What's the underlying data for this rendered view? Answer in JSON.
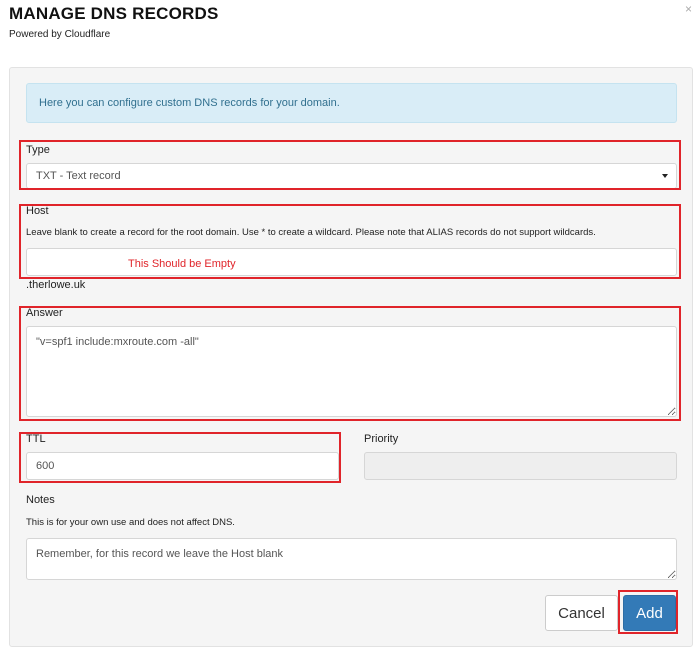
{
  "header": {
    "title": "MANAGE DNS RECORDS",
    "subtitle": "Powered by Cloudflare",
    "close_glyph": "×"
  },
  "info": {
    "text": "Here you can configure custom DNS records for your domain."
  },
  "form": {
    "type": {
      "label": "Type",
      "value": "TXT - Text record"
    },
    "host": {
      "label": "Host",
      "help": "Leave blank to create a record for the root domain. Use * to create a wildcard. Please note that ALIAS records do not support wildcards.",
      "value": "",
      "annotation": "This Should be Empty",
      "suffix": ".therlowe.uk"
    },
    "answer": {
      "label": "Answer",
      "value": "\"v=spf1 include:mxroute.com -all\""
    },
    "ttl": {
      "label": "TTL",
      "value": "600"
    },
    "priority": {
      "label": "Priority",
      "value": ""
    },
    "notes": {
      "label": "Notes",
      "help": "This is for your own use and does not affect DNS.",
      "value": "Remember, for this record we leave the Host blank"
    }
  },
  "actions": {
    "cancel_label": "Cancel",
    "add_label": "Add"
  },
  "colors": {
    "annotation_red": "#e0242a",
    "primary": "#337ab7",
    "info_bg": "#d9edf7",
    "info_text": "#31708f"
  }
}
